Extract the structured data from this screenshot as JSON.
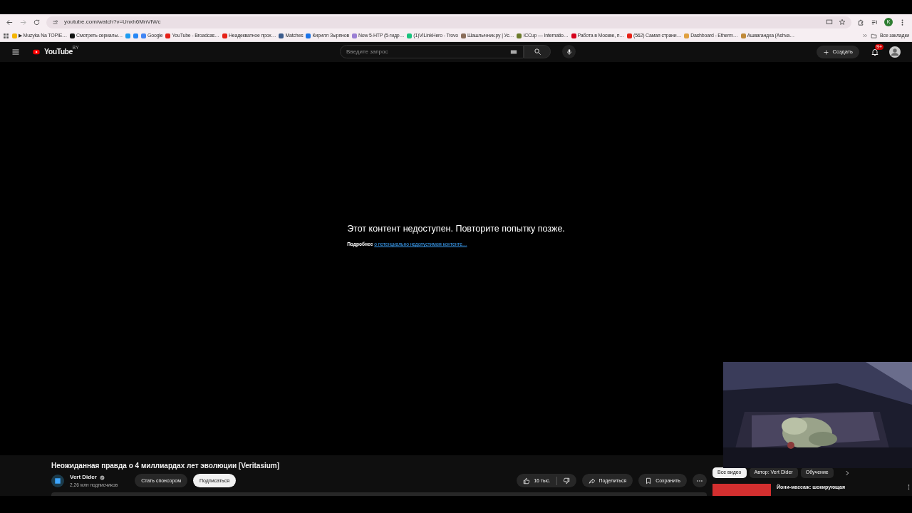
{
  "browser": {
    "url": "youtube.com/watch?v=Unxh6MnVIWc",
    "profile_initial": "K",
    "all_bookmarks": "Все закладки",
    "bookmarks": [
      {
        "label": "▶ Muzyka Na TOPIE…",
        "color": "#f4b400"
      },
      {
        "label": "Смотреть сериалы…",
        "color": "#111111"
      },
      {
        "color": "#1d9bf0"
      },
      {
        "color": "#2787f5"
      },
      {
        "label": "Google",
        "color": "#4285f4"
      },
      {
        "label": "YouTube - Broadcas…",
        "color": "#e62117"
      },
      {
        "label": "Неадекватное прох…",
        "color": "#e62117"
      },
      {
        "label": "Matches",
        "color": "#3b5b8c"
      },
      {
        "label": "Кирилл Зырянов",
        "color": "#1a73e8"
      },
      {
        "label": "Now 5-HTP (5-гидр…",
        "color": "#9b7fd4"
      },
      {
        "label": "(1)VILinkHero - Trovo",
        "color": "#19c37d"
      },
      {
        "label": "Шашлычник.ру | Ус…",
        "color": "#8a6d5a"
      },
      {
        "label": "ICCup — Internatio…",
        "color": "#6b7a2a"
      },
      {
        "label": "Работа в Москве, п…",
        "color": "#d6001c"
      },
      {
        "label": "(562) Самая страни…",
        "color": "#e62117"
      },
      {
        "label": "Dashboard - Etherm…",
        "color": "#e0a040"
      },
      {
        "label": "Ашвагандха (Ashva…",
        "color": "#c08a3a"
      }
    ]
  },
  "header": {
    "logo": "YouTube",
    "region": "BY",
    "search": {
      "placeholder": "Введите запрос"
    },
    "create": "Создать",
    "notifications": "9+"
  },
  "player": {
    "message": "Этот контент недоступен. Повторите попытку позже.",
    "details_prefix": "Подробнее",
    "details_link": "о потенциально недопустимом контенте…"
  },
  "video": {
    "title": "Неожиданная правда о 4 миллиардах лет эволюции [Veritasium]",
    "channel": "Vert Dider",
    "verified": true,
    "subscribers": "2,26 млн подписчиков",
    "sponsor": "Стать спонсором",
    "subscribe": "Подписаться",
    "likes": "16 тыс.",
    "share": "Поделиться",
    "save": "Сохранить"
  },
  "chips": [
    {
      "label": "Все видео",
      "selected": true
    },
    {
      "label": "Автор: Vert Dider",
      "selected": false
    },
    {
      "label": "Обучение",
      "selected": false
    }
  ],
  "recommendations": [
    {
      "title": "Йони-массаж: шокирующая"
    }
  ]
}
